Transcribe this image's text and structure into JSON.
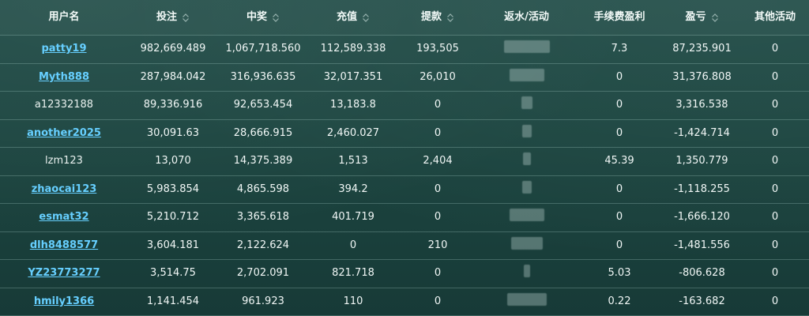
{
  "table": {
    "headers": [
      {
        "label": "用户名",
        "sortable": false
      },
      {
        "label": "投注",
        "sortable": true
      },
      {
        "label": "中奖",
        "sortable": true
      },
      {
        "label": "充值",
        "sortable": true
      },
      {
        "label": "提款",
        "sortable": true
      },
      {
        "label": "返水/活动",
        "sortable": false
      },
      {
        "label": "手续费盈利",
        "sortable": false
      },
      {
        "label": "盈亏",
        "sortable": true
      },
      {
        "label": "其他活动",
        "sortable": false
      }
    ],
    "rows": [
      {
        "username": "patty19",
        "link": true,
        "bet": "982,669.489",
        "win": "1,067,718.560",
        "deposit": "112,589.338",
        "withdraw": "193,505",
        "rebate": "",
        "fee_profit": "7.3",
        "profit_loss": "87,235.901",
        "other": "0"
      },
      {
        "username": "Myth888",
        "link": true,
        "bet": "287,984.042",
        "win": "316,936.635",
        "deposit": "32,017.351",
        "withdraw": "26,010",
        "rebate": "",
        "fee_profit": "0",
        "profit_loss": "31,376.808",
        "other": "0"
      },
      {
        "username": "a12332188",
        "link": false,
        "bet": "89,336.916",
        "win": "92,653.454",
        "deposit": "13,183.8",
        "withdraw": "0",
        "rebate": "",
        "fee_profit": "0",
        "profit_loss": "3,316.538",
        "other": "0"
      },
      {
        "username": "another2025",
        "link": true,
        "bet": "30,091.63",
        "win": "28,666.915",
        "deposit": "2,460.027",
        "withdraw": "0",
        "rebate": "",
        "fee_profit": "0",
        "profit_loss": "-1,424.714",
        "other": "0"
      },
      {
        "username": "lzm123",
        "link": false,
        "bet": "13,070",
        "win": "14,375.389",
        "deposit": "1,513",
        "withdraw": "2,404",
        "rebate": "",
        "fee_profit": "45.39",
        "profit_loss": "1,350.779",
        "other": "0"
      },
      {
        "username": "zhaocai123",
        "link": true,
        "bet": "5,983.854",
        "win": "4,865.598",
        "deposit": "394.2",
        "withdraw": "0",
        "rebate": "",
        "fee_profit": "0",
        "profit_loss": "-1,118.255",
        "other": "0"
      },
      {
        "username": "esmat32",
        "link": true,
        "bet": "5,210.712",
        "win": "3,365.618",
        "deposit": "401.719",
        "withdraw": "0",
        "rebate": "",
        "fee_profit": "0",
        "profit_loss": "-1,666.120",
        "other": "0"
      },
      {
        "username": "dlh8488577",
        "link": true,
        "bet": "3,604.181",
        "win": "2,122.624",
        "deposit": "0",
        "withdraw": "210",
        "rebate": "",
        "fee_profit": "0",
        "profit_loss": "-1,481.556",
        "other": "0"
      },
      {
        "username": "YZ23773277",
        "link": true,
        "bet": "3,514.75",
        "win": "2,702.091",
        "deposit": "821.718",
        "withdraw": "0",
        "rebate": "",
        "fee_profit": "5.03",
        "profit_loss": "-806.628",
        "other": "0"
      },
      {
        "username": "hmily1366",
        "link": true,
        "bet": "1,141.454",
        "win": "961.923",
        "deposit": "110",
        "withdraw": "0",
        "rebate": "",
        "fee_profit": "0.22",
        "profit_loss": "-163.682",
        "other": "0"
      }
    ]
  },
  "colors": {
    "background": "#1f4b46",
    "link": "#66cfff",
    "text": "#e9f1ef",
    "divider": "#afd6d0"
  }
}
